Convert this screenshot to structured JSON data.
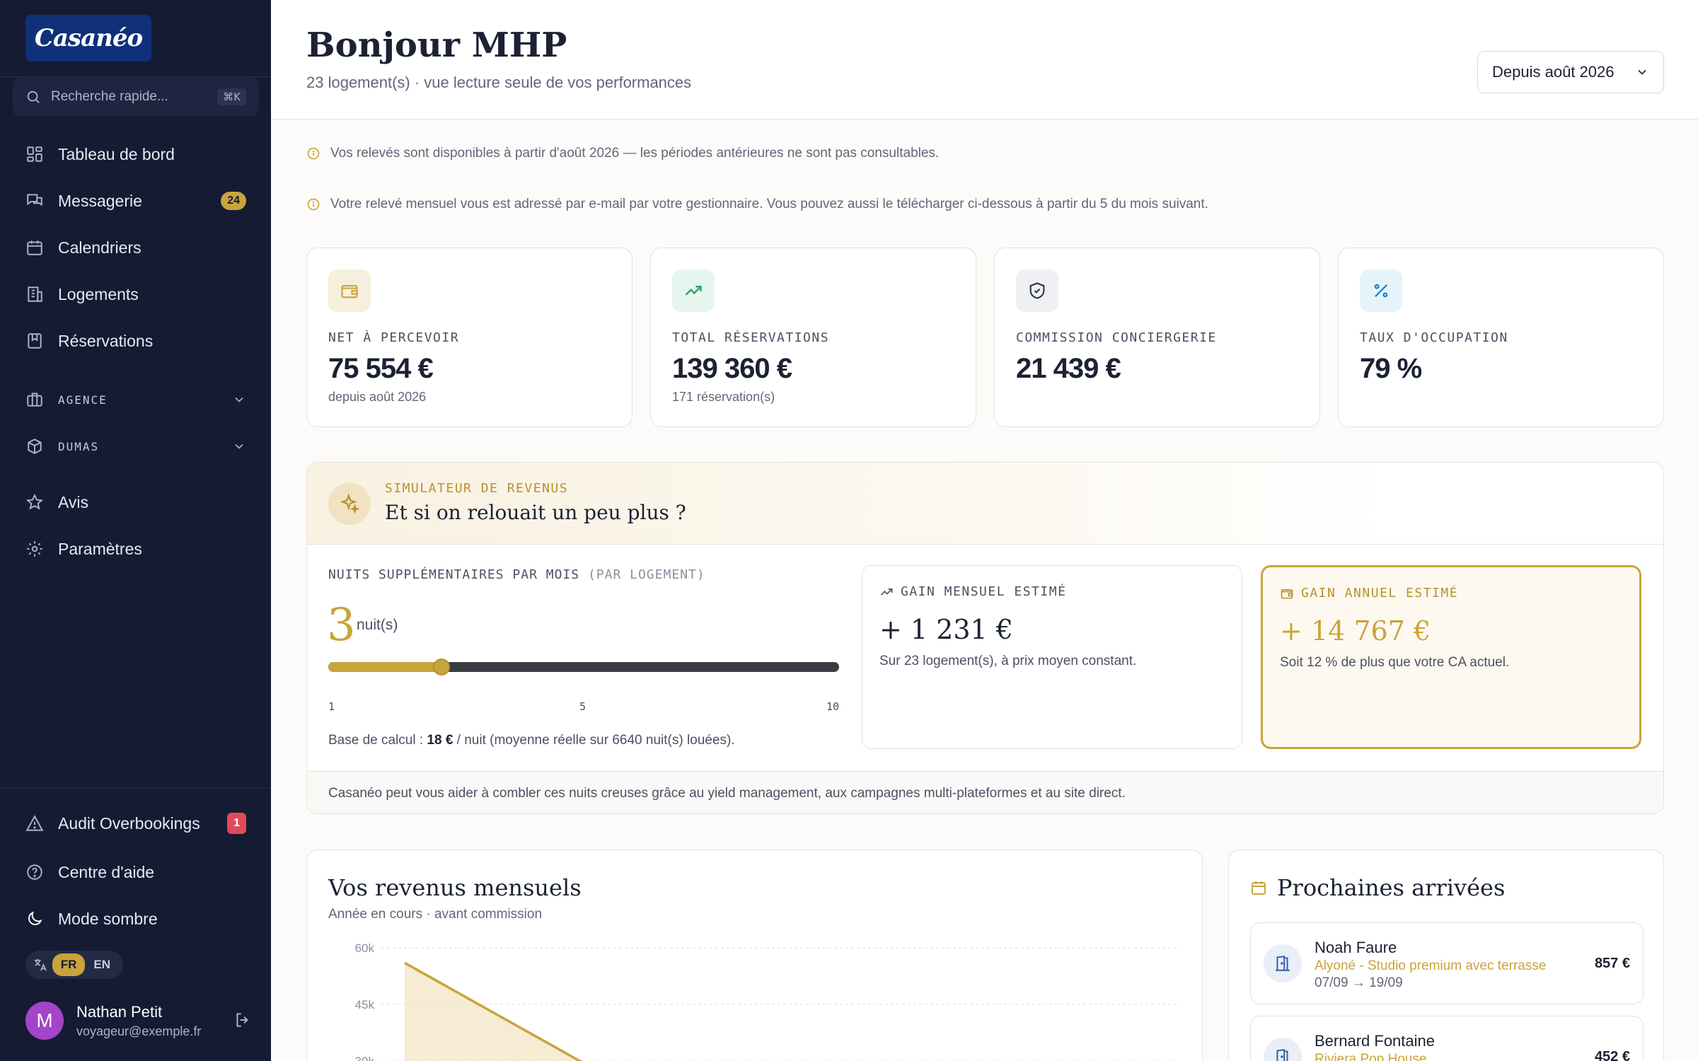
{
  "brand": {
    "logo_text": "Casanéo"
  },
  "search": {
    "placeholder": "Recherche rapide...",
    "shortcut": "⌘K"
  },
  "nav": {
    "items": [
      {
        "label": "Tableau de bord",
        "icon": "dashboard-icon"
      },
      {
        "label": "Messagerie",
        "icon": "messages-icon",
        "badge": "24"
      },
      {
        "label": "Calendriers",
        "icon": "calendar-icon"
      },
      {
        "label": "Logements",
        "icon": "building-icon"
      },
      {
        "label": "Réservations",
        "icon": "bookmark-icon"
      }
    ],
    "groups": [
      {
        "label": "AGENCE",
        "icon": "briefcase-icon"
      },
      {
        "label": "DUMAS",
        "icon": "package-icon"
      }
    ],
    "secondary": [
      {
        "label": "Avis",
        "icon": "star-icon"
      },
      {
        "label": "Paramètres",
        "icon": "gear-icon"
      }
    ],
    "bottom": [
      {
        "label": "Audit Overbookings",
        "icon": "warning-icon",
        "badge": "1"
      },
      {
        "label": "Centre d'aide",
        "icon": "help-icon"
      },
      {
        "label": "Mode sombre",
        "icon": "moon-icon"
      }
    ]
  },
  "language": {
    "options": [
      "FR",
      "EN"
    ],
    "active": "FR"
  },
  "user": {
    "initial": "M",
    "name": "Nathan Petit",
    "email": "voyageur@exemple.fr",
    "avatar_color": "#a444c9"
  },
  "header": {
    "title": "Bonjour MHP",
    "subtitle": "23 logement(s) · vue lecture seule de vos performances",
    "period": "Depuis août 2026"
  },
  "notices": [
    "Vos relevés sont disponibles à partir d'août 2026 — les périodes antérieures ne sont pas consultables.",
    "Votre relevé mensuel vous est adressé par e-mail par votre gestionnaire. Vous pouvez aussi le télécharger ci-dessous à partir du 5 du mois suivant."
  ],
  "kpis": [
    {
      "label": "NET À PERCEVOIR",
      "value": "75 554 €",
      "sub": "depuis août 2026",
      "icon": "wallet-icon"
    },
    {
      "label": "TOTAL RÉSERVATIONS",
      "value": "139 360 €",
      "sub": "171 réservation(s)",
      "icon": "trending-up-icon"
    },
    {
      "label": "COMMISSION CONCIERGERIE",
      "value": "21 439 €",
      "sub": "",
      "icon": "shield-icon"
    },
    {
      "label": "TAUX D'OCCUPATION",
      "value": "79 %",
      "sub": "",
      "icon": "percent-icon"
    }
  ],
  "simulator": {
    "eyebrow": "SIMULATEUR DE REVENUS",
    "title": "Et si on relouait un peu plus ?",
    "slider_label": "NUITS SUPPLÉMENTAIRES PAR MOIS",
    "slider_label_suffix": "(PAR LOGEMENT)",
    "nights": "3",
    "nights_unit": "nuit(s)",
    "slider_min": 1,
    "slider_max": 10,
    "slider_value": 3,
    "ticks": [
      "1",
      "5",
      "10"
    ],
    "base_prefix": "Base de calcul : ",
    "base_price": "18 €",
    "base_suffix": " / nuit (moyenne réelle sur 6640 nuit(s) louées).",
    "monthly": {
      "label": "GAIN MENSUEL ESTIMÉ",
      "value": "+ 1 231 €",
      "sub": "Sur 23 logement(s), à prix moyen constant."
    },
    "annual": {
      "label": "GAIN ANNUEL ESTIMÉ",
      "value": "+ 14 767 €",
      "sub": "Soit 12 % de plus que votre CA actuel."
    },
    "footer": "Casanéo peut vous aider à combler ces nuits creuses grâce au yield management, aux campagnes multi-plateformes et au site direct."
  },
  "revenue": {
    "title": "Vos revenus mensuels",
    "subtitle": "Année en cours · avant commission"
  },
  "chart_data": {
    "type": "area",
    "title": "Vos revenus mensuels",
    "subtitle": "Année en cours · avant commission",
    "y_ticks": [
      "60k",
      "45k",
      "30k"
    ],
    "ylim": [
      0,
      60000
    ],
    "series": [
      {
        "values": [
          56000,
          29000
        ]
      }
    ],
    "grid": true,
    "color": "#c9a43b"
  },
  "arrivals": {
    "title": "Prochaines arrivées",
    "items": [
      {
        "name": "Noah Faure",
        "property": "Alyoné - Studio premium avec terrasse",
        "dates": "07/09 → 19/09",
        "price": "857 €"
      },
      {
        "name": "Bernard Fontaine",
        "property": "Riviera Pop House",
        "dates": "",
        "price": "452 €"
      }
    ]
  },
  "colors": {
    "sidebar": "#141b33",
    "accent": "#c9a43b",
    "danger": "#e04a5a"
  }
}
